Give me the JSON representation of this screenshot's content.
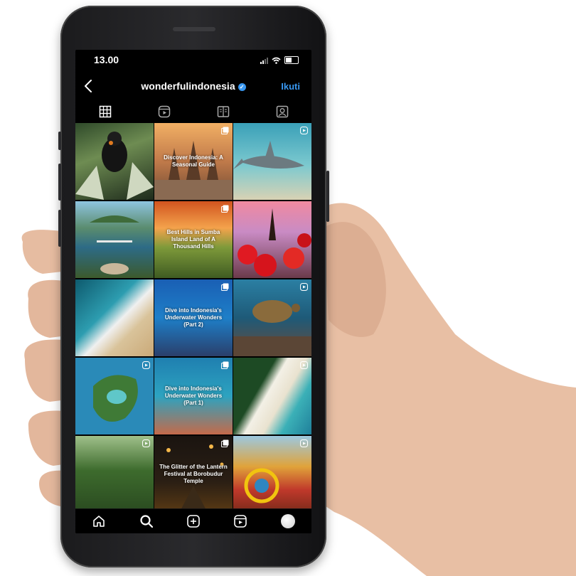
{
  "status_bar": {
    "time": "13.00"
  },
  "profile": {
    "username": "wonderfulindonesia",
    "verified_icon": "verified-badge-icon",
    "follow_label": "Ikuti"
  },
  "tabs": [
    {
      "icon": "grid-icon"
    },
    {
      "icon": "reels-icon"
    },
    {
      "icon": "guide-icon"
    },
    {
      "icon": "tagged-icon"
    }
  ],
  "grid": {
    "captions": {
      "c2": "Discover Indonesia: A Seasonal Guide",
      "c5": "Best Hills in Sumba Island Land of A Thousand Hills",
      "c8": "Dive into Indonesia's Underwater Wonders (Part 2)",
      "c11": "Dive into Indonesia's Underwater Wonders (Part 1)",
      "c14": "The Glitter of the Lantern Festival at Borobudur Temple"
    }
  },
  "bottom_nav": [
    {
      "icon": "home-icon"
    },
    {
      "icon": "search-icon"
    },
    {
      "icon": "add-post-icon"
    },
    {
      "icon": "reels-icon"
    },
    {
      "icon": "profile-avatar"
    }
  ],
  "colors": {
    "accent": "#3897f0",
    "background": "#000000",
    "text": "#ffffff"
  }
}
